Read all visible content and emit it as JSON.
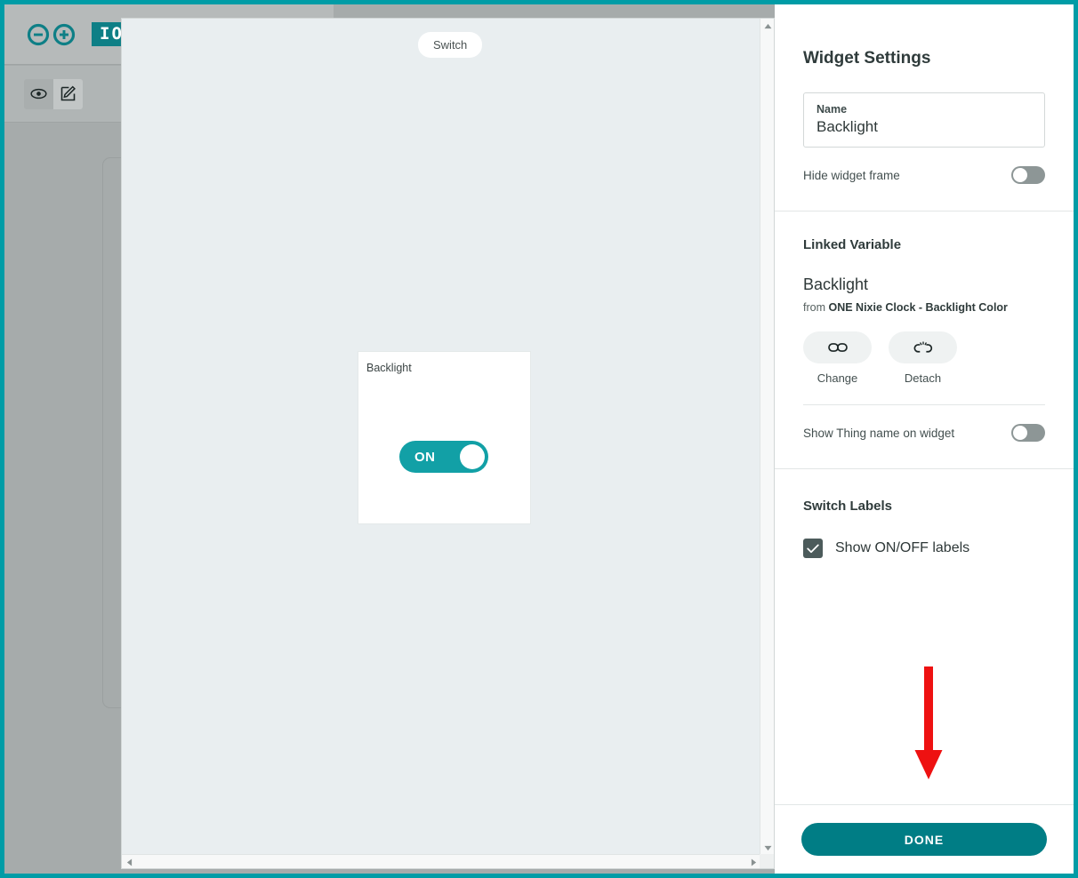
{
  "app": {
    "brand_name": "IOT",
    "logo_icon": "arduino-infinity-logo",
    "view_icon": "eye-icon",
    "edit_icon": "pencil-square-icon"
  },
  "canvas": {
    "widget_type_tag": "Switch",
    "widget": {
      "label": "Backlight",
      "toggle_state_label": "ON"
    },
    "scrollbar": {
      "up_icon": "chevron-up-icon",
      "down_icon": "chevron-down-icon",
      "left_icon": "chevron-left-icon",
      "right_icon": "chevron-right-icon"
    }
  },
  "settings": {
    "title": "Widget Settings",
    "name_field": {
      "label": "Name",
      "value": "Backlight",
      "placeholder": "Name"
    },
    "hide_widget_frame": {
      "label": "Hide widget frame",
      "state": "off"
    },
    "linked_variable": {
      "heading": "Linked Variable",
      "variable_name": "Backlight",
      "from_prefix": "from ",
      "from_source": "ONE Nixie Clock - Backlight Color",
      "change": {
        "caption": "Change",
        "icon": "chain-link-icon"
      },
      "detach": {
        "caption": "Detach",
        "icon": "broken-chain-icon"
      },
      "show_thing_name": {
        "label": "Show Thing name on widget",
        "state": "off"
      }
    },
    "switch_labels": {
      "heading": "Switch Labels",
      "show_on_off": {
        "label": "Show ON/OFF labels",
        "checked": true,
        "check_icon": "checkmark-icon"
      }
    },
    "done_label": "DONE"
  },
  "annotation": {
    "arrow_icon": "down-arrow-annotation",
    "color": "#ee1111"
  },
  "colors": {
    "brand_teal": "#009ca6",
    "toggle_on_teal": "#12a0a6",
    "done_teal": "#007d85",
    "checkbox_slate": "#4c5b5b",
    "annotation_red": "#ee1111"
  }
}
